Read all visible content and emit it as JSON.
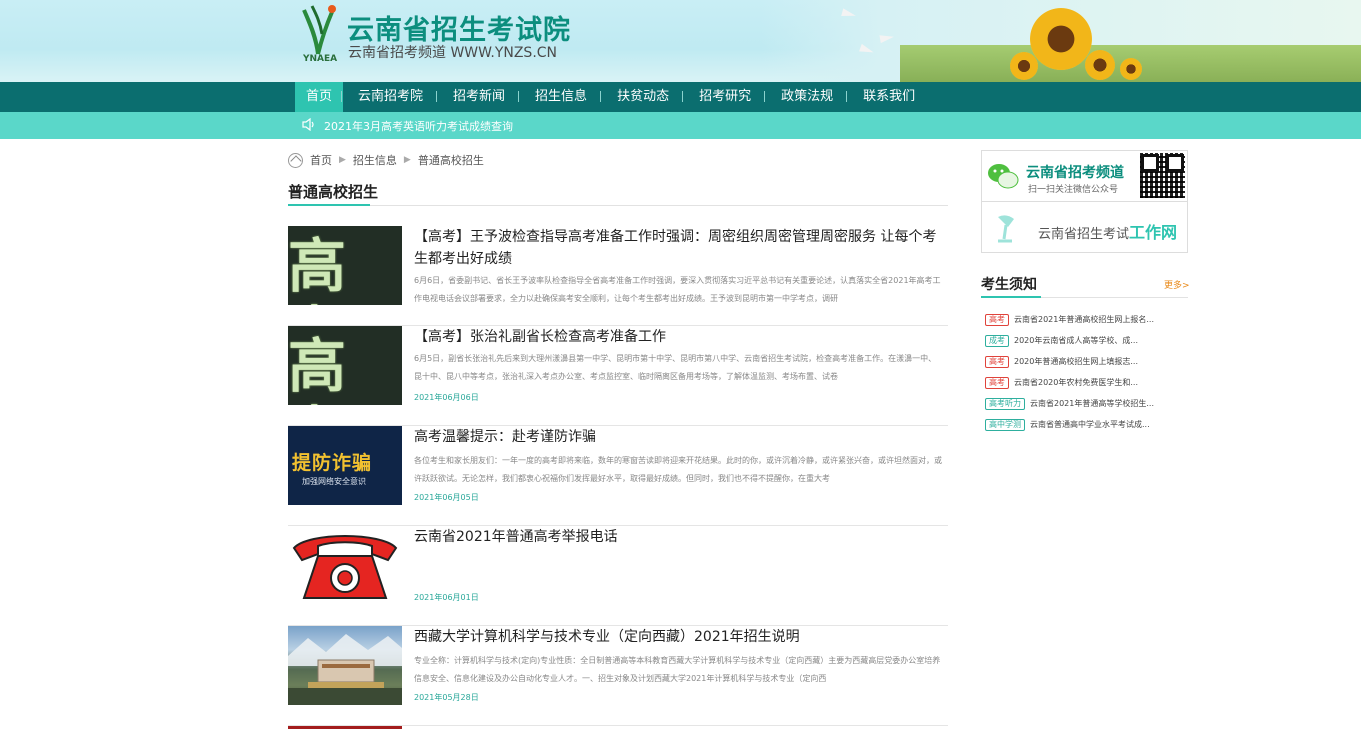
{
  "header": {
    "title": "云南省招生考试院",
    "subtitle": "云南省招考频道  WWW.YNZS.CN",
    "logo_text": "YNAEA"
  },
  "nav": {
    "items": [
      "首页",
      "云南招考院",
      "招考新闻",
      "招生信息",
      "扶贫动态",
      "招考研究",
      "政策法规",
      "联系我们"
    ]
  },
  "notice": {
    "text": "2021年3月高考英语听力考试成绩查询"
  },
  "breadcrumb": {
    "items": [
      "首页",
      "招生信息",
      "普通高校招生"
    ]
  },
  "section": {
    "title": "普通高校招生"
  },
  "news": [
    {
      "title": "【高考】王予波检查指导高考准备工作时强调：周密组织周密管理周密服务 让每个考生都考出好成绩",
      "summary": "6月6日，省委副书记、省长王予波率队检查指导全省高考准备工作时强调，要深入贯彻落实习近平总书记有关重要论述，认真落实全省2021年高考工作电视电话会议部署要求，全力以赴确保高考安全顺利，让每个考生都考出好成绩。王予波到昆明市第一中学考点，调研",
      "date": "",
      "thumb": {
        "type": "gaokao",
        "text": "高考"
      }
    },
    {
      "title": "【高考】张治礼副省长检查高考准备工作",
      "summary": "6月5日，副省长张治礼先后来到大理州漾濞县第一中学、昆明市第十中学、昆明市第八中学、云南省招生考试院，检查高考准备工作。在漾濞一中、昆十中、昆八中等考点，张治礼深入考点办公室、考点监控室、临时隔离区备用考场等，了解体温监测、考场布置、试卷",
      "date": "2021年06月06日",
      "thumb": {
        "type": "gaokao",
        "text": "高考"
      }
    },
    {
      "title": "高考温馨提示：赴考谨防诈骗",
      "summary": "各位考生和家长朋友们：一年一度的高考即将来临，数年的寒窗苦读即将迎来开花结果。此时的你，或许沉着冷静，或许紧张兴奋，或许坦然面对，或许跃跃欲试。无论怎样，我们都衷心祝福你们发挥最好水平，取得最好成绩。但同时，我们也不得不提醒你，在重大考",
      "date": "2021年06月05日",
      "thumb": {
        "type": "fraud",
        "text": "提防诈骗",
        "sub": "加强网络安全意识"
      }
    },
    {
      "title": "云南省2021年普通高考举报电话",
      "summary": "",
      "date": "2021年06月01日",
      "thumb": {
        "type": "phone"
      }
    },
    {
      "title": "西藏大学计算机科学与技术专业（定向西藏）2021年招生说明",
      "summary": "专业全称：计算机科学与技术(定向)专业性质：全日制普通高等本科教育西藏大学计算机科学与技术专业（定向西藏）主要为西藏高层党委办公室培养信息安全、信息化建设及办公自动化专业人才。一、招生对象及计划西藏大学2021年计算机科学与技术专业（定向西",
      "date": "2021年05月28日",
      "thumb": {
        "type": "tibet"
      }
    }
  ],
  "sidebar": {
    "wechat_title": "云南省招考频道",
    "wechat_sub": "扫一扫关注微信公众号",
    "work_prefix": "云南省招生考试",
    "work_suffix": "工作网",
    "notes_title": "考生须知",
    "notes_more": "更多>",
    "notes": [
      {
        "tag": "高考",
        "tag_color": "red",
        "text": "云南省2021年普通高校招生网上报名..."
      },
      {
        "tag": "成考",
        "tag_color": "green",
        "text": "2020年云南省成人高等学校、成..."
      },
      {
        "tag": "高考",
        "tag_color": "red",
        "text": "2020年普通高校招生网上填报志..."
      },
      {
        "tag": "高考",
        "tag_color": "red",
        "text": "云南省2020年农村免费医学生和..."
      },
      {
        "tag": "高考听力",
        "tag_color": "green",
        "text": "云南省2021年普通高等学校招生..."
      },
      {
        "tag": "高中学测",
        "tag_color": "green",
        "text": "云南省普通高中学业水平考试成..."
      }
    ]
  }
}
